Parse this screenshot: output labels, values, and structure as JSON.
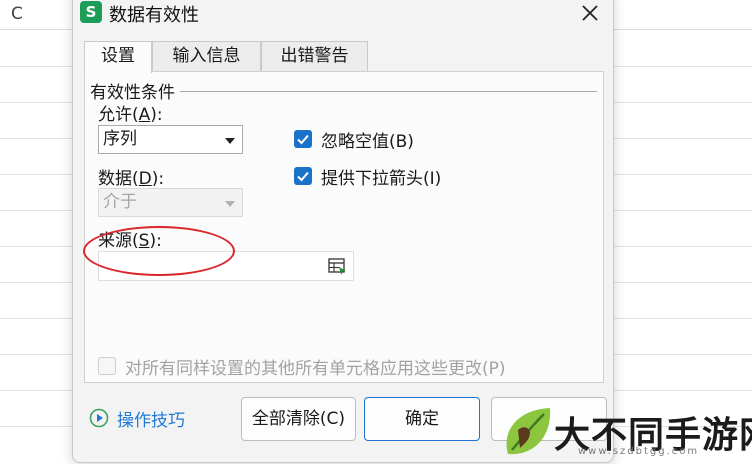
{
  "sheet": {
    "column_label": "C"
  },
  "dialog": {
    "app_icon_letter": "S",
    "title": "数据有效性",
    "tabs": [
      {
        "label": "设置",
        "active": true
      },
      {
        "label": "输入信息",
        "active": false
      },
      {
        "label": "出错警告",
        "active": false
      }
    ],
    "group_title": "有效性条件",
    "allow": {
      "label": "允许(A):",
      "label_text": "允许(",
      "label_key": "A",
      "label_tail": "):",
      "value": "序列"
    },
    "data": {
      "label_text": "数据(",
      "label_key": "D",
      "label_tail": "):",
      "value": "介于"
    },
    "source": {
      "label_text": "来源(",
      "label_key": "S",
      "label_tail": "):",
      "value": ""
    },
    "checkboxes": [
      {
        "label": "忽略空值(B)",
        "checked": true
      },
      {
        "label": "提供下拉箭头(I)",
        "checked": true
      }
    ],
    "apply_all": {
      "label": "对所有同样设置的其他所有单元格应用这些更改(P)",
      "checked": false,
      "disabled": true
    },
    "footer": {
      "tips_label": "操作技巧",
      "clear_label": "全部清除(C)",
      "ok_label": "确定",
      "cancel_label": ""
    }
  },
  "watermark": {
    "text": "大不同手游网",
    "url": "www.szdbtgg.com"
  },
  "colors": {
    "accent": "#1a73c9",
    "annotation": "#d8262a",
    "link": "#1f7ad6",
    "brand": "#1e9d58"
  }
}
